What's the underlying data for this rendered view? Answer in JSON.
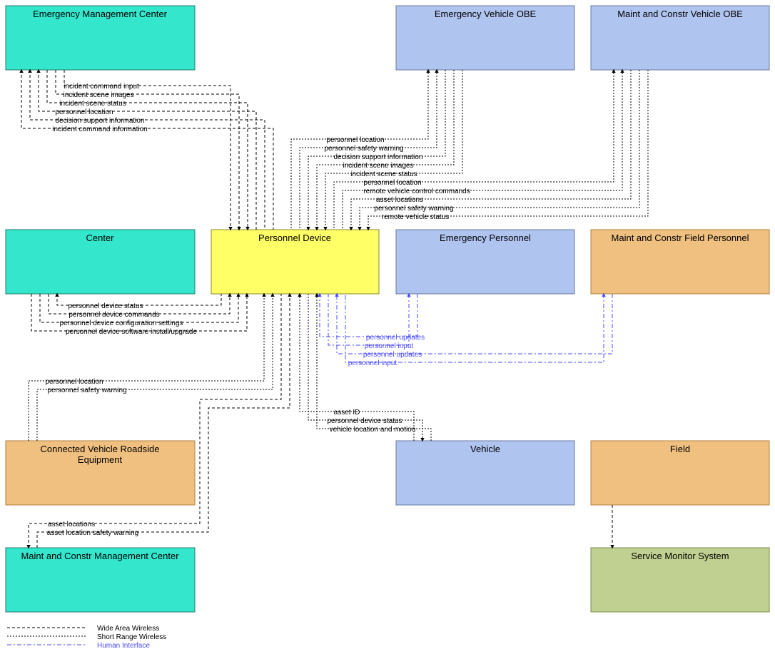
{
  "boxes": {
    "emc": "Emergency Management Center",
    "center": "Center",
    "cvre_l1": "Connected Vehicle Roadside",
    "cvre_l2": "Equipment",
    "mcmc": "Maint and Constr Management Center",
    "pd": "Personnel Device",
    "evobe": "Emergency Vehicle OBE",
    "mcvobe": "Maint and Constr Vehicle OBE",
    "ep": "Emergency Personnel",
    "mcfp": "Maint and Constr Field Personnel",
    "vehicle": "Vehicle",
    "field": "Field",
    "sms": "Service Monitor System"
  },
  "flows": {
    "emc1": "incident command input",
    "emc2": "incident scene images",
    "emc3": "incident scene status",
    "emc4": "personnel location",
    "emc5": "decision support information",
    "emc6": "incident command information",
    "ev1": "personnel location",
    "ev2": "personnel safety warning",
    "ev3": "decision support information",
    "ev4": "incident scene images",
    "ev5": "incident scene status",
    "mv1": "personnel location",
    "mv2": "remote vehicle control commands",
    "mv3": "asset locations",
    "mv4": "personnel safety warning",
    "mv5": "remote vehicle status",
    "c1": "personnel device status",
    "c2": "personnel device commands",
    "c3": "personnel device configuration settings",
    "c4": "personnel device software install/upgrade",
    "ep1": "personnel updates",
    "ep2": "personnel input",
    "mp1": "personnel updates",
    "mp2": "personnel input",
    "cv1": "personnel location",
    "cv2": "personnel safety warning",
    "v1": "asset ID",
    "v2": "personnel device status",
    "v3": "vehicle location and motion",
    "mc1": "asset locations",
    "mc2": "asset location safety warning"
  },
  "legend": {
    "l1": "Wide Area Wireless",
    "l2": "Short Range Wireless",
    "l3": "Human Interface"
  }
}
